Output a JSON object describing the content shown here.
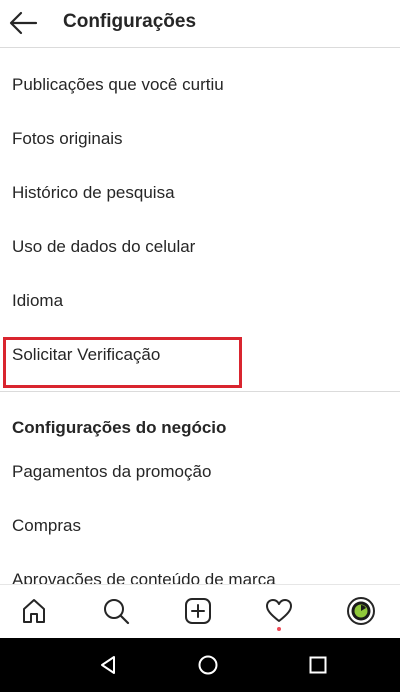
{
  "header": {
    "title": "Configurações",
    "back_icon": "arrow-left-icon"
  },
  "menu": {
    "items": [
      {
        "label": "Publicações que você curtiu"
      },
      {
        "label": "Fotos originais"
      },
      {
        "label": "Histórico de pesquisa"
      },
      {
        "label": "Uso de dados do celular"
      },
      {
        "label": "Idioma"
      },
      {
        "label": "Solicitar Verificação",
        "highlighted": true
      }
    ]
  },
  "business": {
    "title": "Configurações do negócio",
    "items": [
      {
        "label": "Pagamentos da promoção"
      },
      {
        "label": "Compras"
      },
      {
        "label": "Aprovações de conteúdo de marca"
      }
    ]
  },
  "bottom_nav": {
    "items": [
      {
        "icon": "home-icon"
      },
      {
        "icon": "search-icon"
      },
      {
        "icon": "add-post-icon"
      },
      {
        "icon": "heart-icon",
        "has_notification": true
      },
      {
        "icon": "profile-avatar-icon"
      }
    ]
  },
  "system_nav": {
    "items": [
      {
        "icon": "back-triangle-icon"
      },
      {
        "icon": "home-circle-icon"
      },
      {
        "icon": "recents-square-icon"
      }
    ]
  },
  "colors": {
    "highlight_border": "#d9252f",
    "notification_dot": "#ed4956",
    "text": "#262626",
    "divider": "#dbdbdb"
  }
}
